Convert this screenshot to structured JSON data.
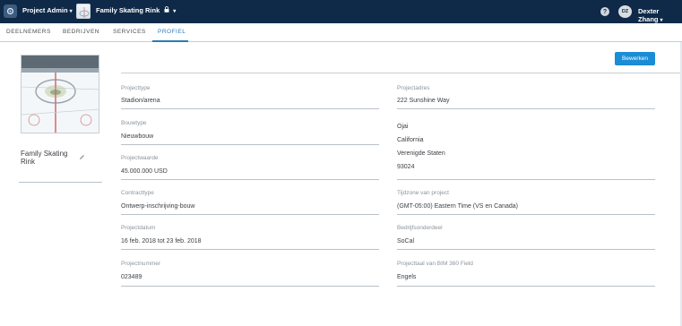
{
  "topbar": {
    "app_name": "Project Admin",
    "app_caret": "▾",
    "project_name": "Family Skating Rink",
    "project_lock": "🔒",
    "project_caret": "▾",
    "help": "?",
    "user_initials": "DZ",
    "user_name": "Dexter Zhang",
    "user_caret": "▾"
  },
  "tabs": [
    {
      "label": "DEELNEMERS",
      "active": false
    },
    {
      "label": "BEDRIJVEN",
      "active": false
    },
    {
      "label": "SERVICES",
      "active": false
    },
    {
      "label": "PROFIEL",
      "active": true
    }
  ],
  "sidebar": {
    "project_title": "Family Skating Rink"
  },
  "actions": {
    "edit_label": "Bewerken"
  },
  "left_fields": [
    {
      "label": "Projecttype",
      "value": "Stadion/arena"
    },
    {
      "label": "Bouwtype",
      "value": "Nieuwbouw"
    },
    {
      "label": "Projectwaarde",
      "value": "45.000.000 USD"
    },
    {
      "label": "Contracttype",
      "value": "Ontwerp-inschrijving-bouw"
    },
    {
      "label": "Projectdatum",
      "value": "16 feb. 2018 tot 23 feb. 2018"
    },
    {
      "label": "Projectnummer",
      "value": "023489"
    }
  ],
  "address": {
    "label": "Projectadres",
    "street": "222 Sunshine Way",
    "city": "Ojai",
    "state": "California",
    "country": "Verenigde Staten",
    "zip": "93024"
  },
  "right_fields": [
    {
      "label": "Tijdzone van project",
      "value": "(GMT-05:00) Eastern Time (VS en Canada)"
    },
    {
      "label": "Bedrijfsonderdeel",
      "value": "SoCal"
    },
    {
      "label": "Projecttaal van BIM 360 Field",
      "value": "Engels"
    }
  ],
  "colors": {
    "topbar_bg": "#0f2a48",
    "accent": "#2a7cb8",
    "button_bg": "#1b8cd6"
  }
}
